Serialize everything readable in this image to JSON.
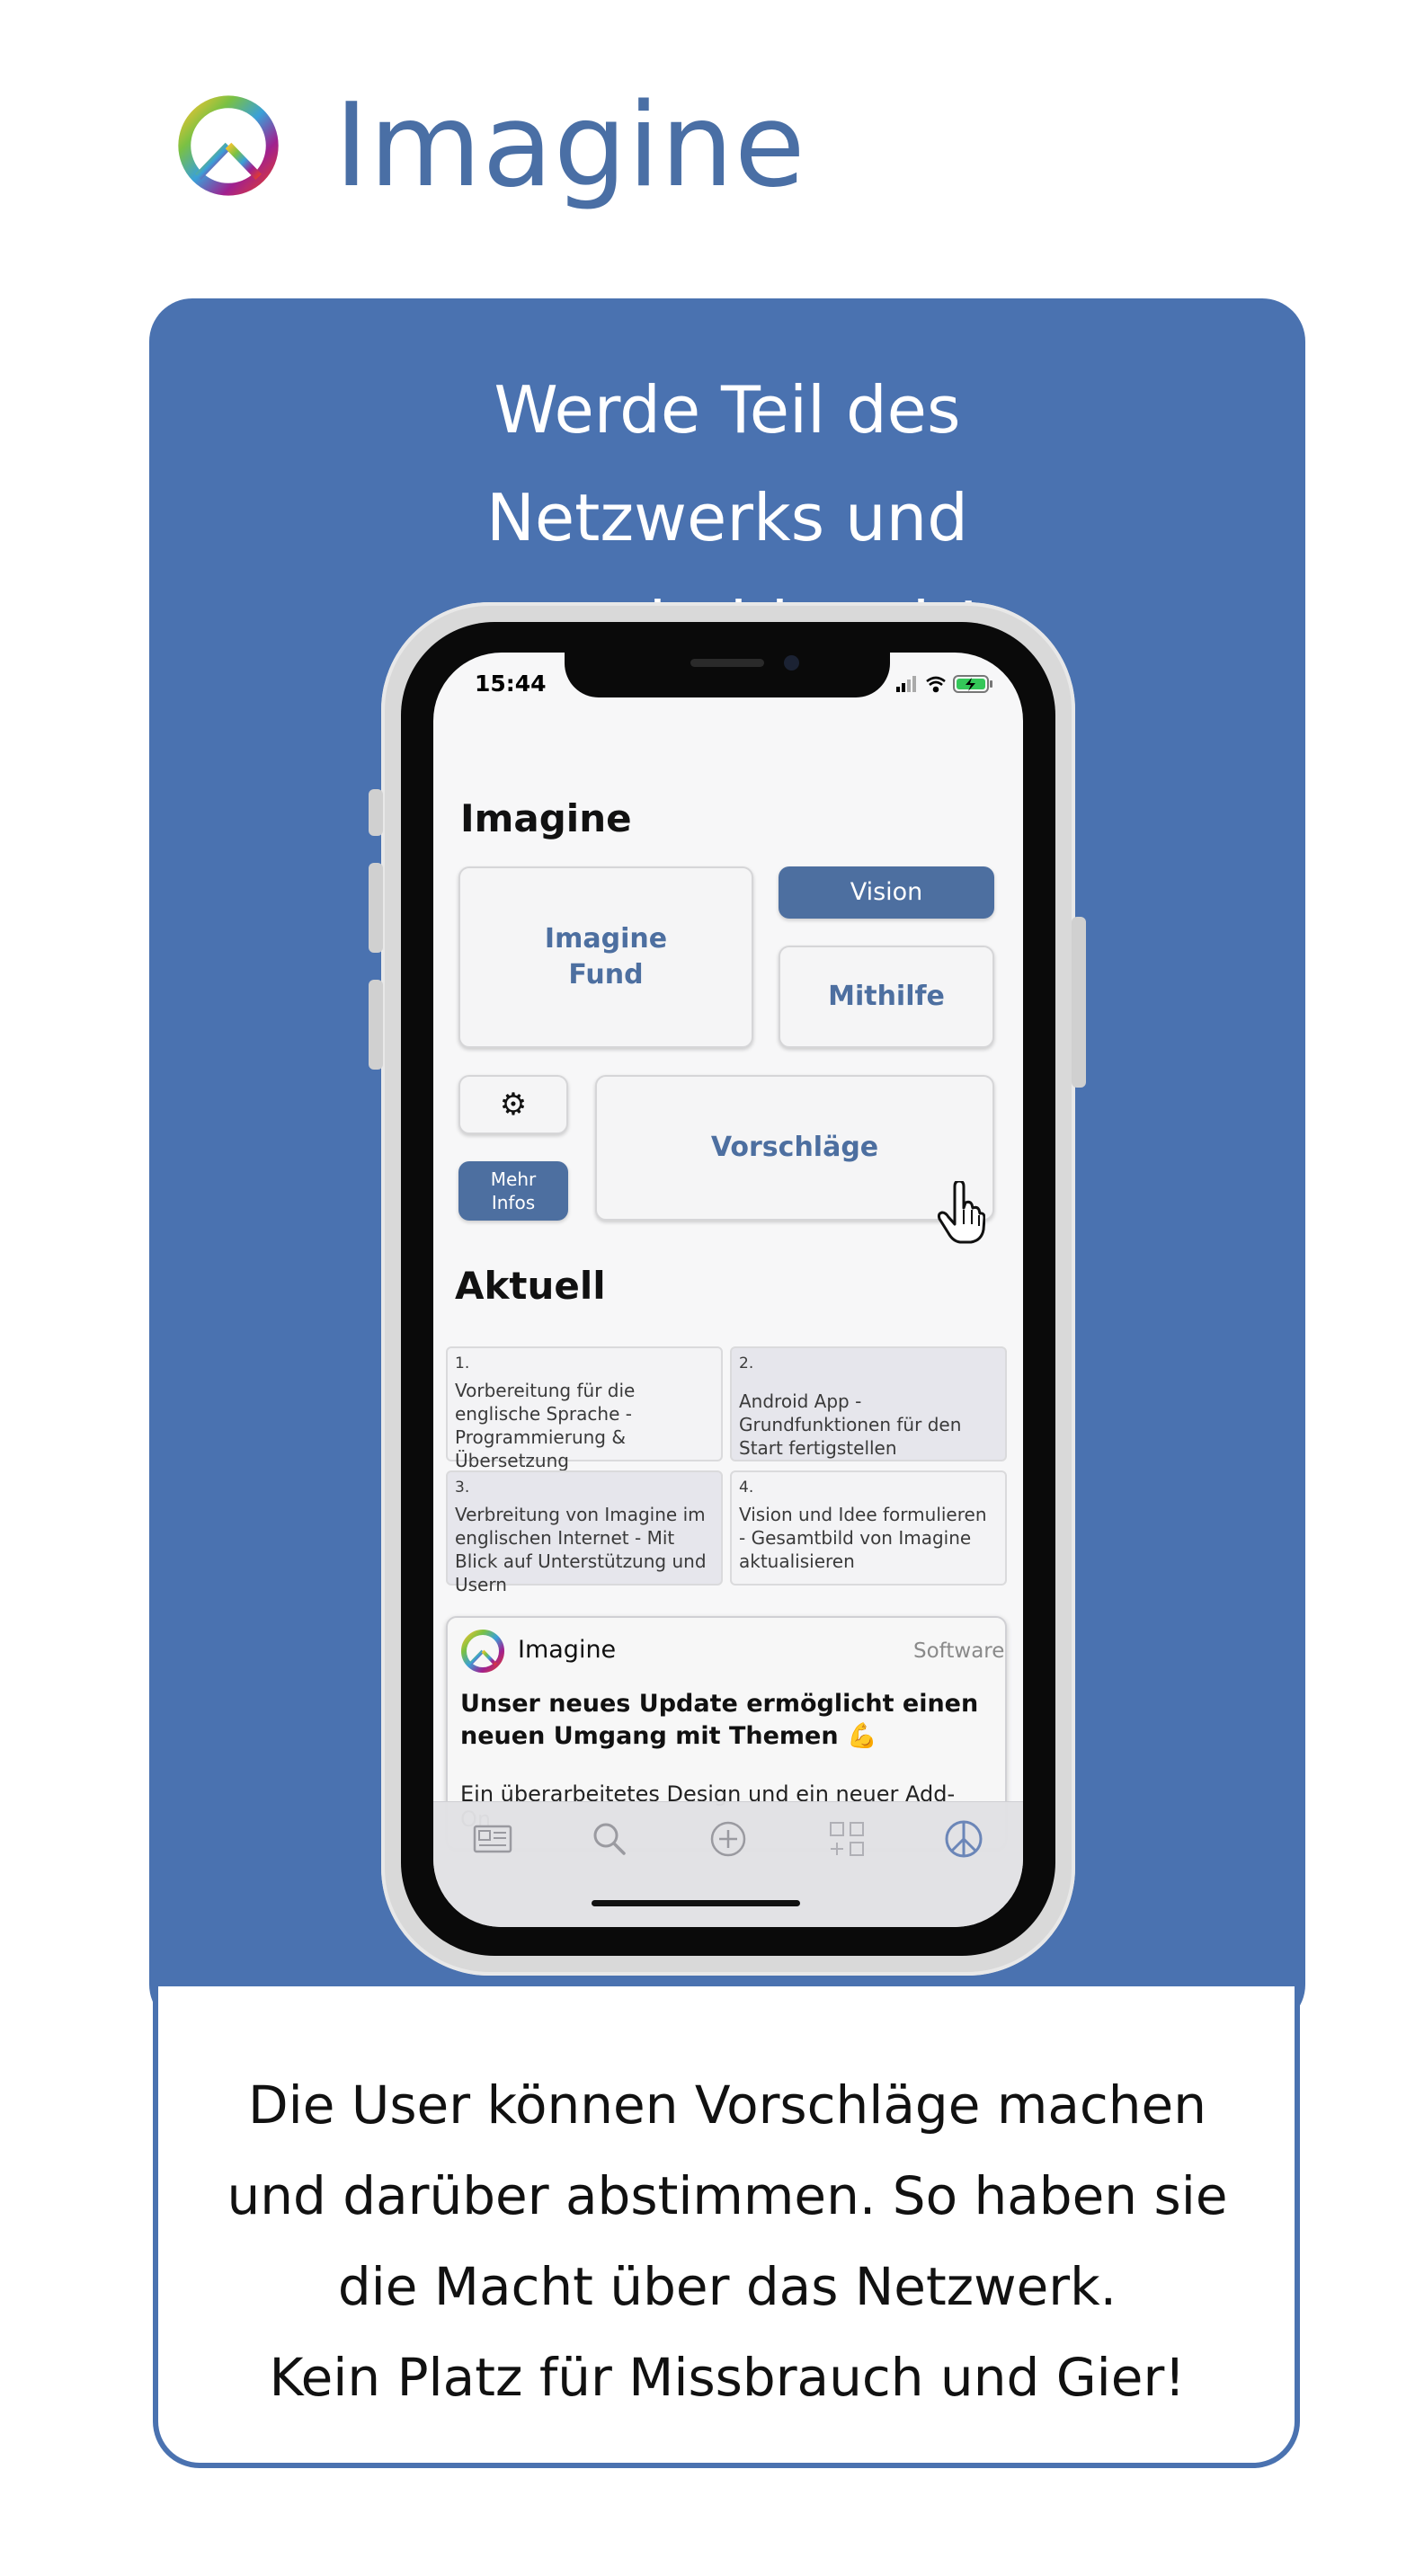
{
  "header": {
    "app_name": "Imagine"
  },
  "promo": {
    "headline": "Werde Teil des Netzwerks und entscheide mit!"
  },
  "caption": {
    "lines": [
      "Die User können Vorschläge machen",
      "und darüber abstimmen. So haben sie",
      "die Macht über das Netzwerk.",
      "Kein Platz für Missbrauch und Gier!"
    ]
  },
  "phone": {
    "status_time": "15:44",
    "screen_title": "Imagine",
    "cards": {
      "fund": "Imagine Fund",
      "vision": "Vision",
      "mithilfe": "Mithilfe",
      "settings_icon": "⚙",
      "mehr_infos": "Mehr Infos",
      "vorschlaege": "Vorschläge"
    },
    "aktuell": {
      "title": "Aktuell",
      "tasks": [
        {
          "num": "1.",
          "text": "Vorbereitung für die englische Sprache - Programmierung & Übersetzung"
        },
        {
          "num": "2.",
          "text": "Android App - Grundfunktionen für den Start fertigstellen"
        },
        {
          "num": "3.",
          "text": "Verbreitung von Imagine im englischen Internet - Mit Blick auf Unterstützung und Usern"
        },
        {
          "num": "4.",
          "text": "Vision und Idee formulieren - Gesamtbild von Imagine aktualisieren"
        }
      ]
    },
    "post": {
      "author": "Imagine",
      "category": "Software",
      "headline": "Unser neues Update ermöglicht einen neuen Umgang mit Themen 💪",
      "body": "Ein überarbeitetes Design und ein neuer Add-On"
    },
    "tabs": [
      "feed-icon",
      "search-icon",
      "add-icon",
      "apps-icon",
      "peace-icon"
    ]
  },
  "colors": {
    "brand_blue": "#4a72b0",
    "card_blue": "#4d6fa0",
    "title_blue": "#4a6fa5"
  }
}
